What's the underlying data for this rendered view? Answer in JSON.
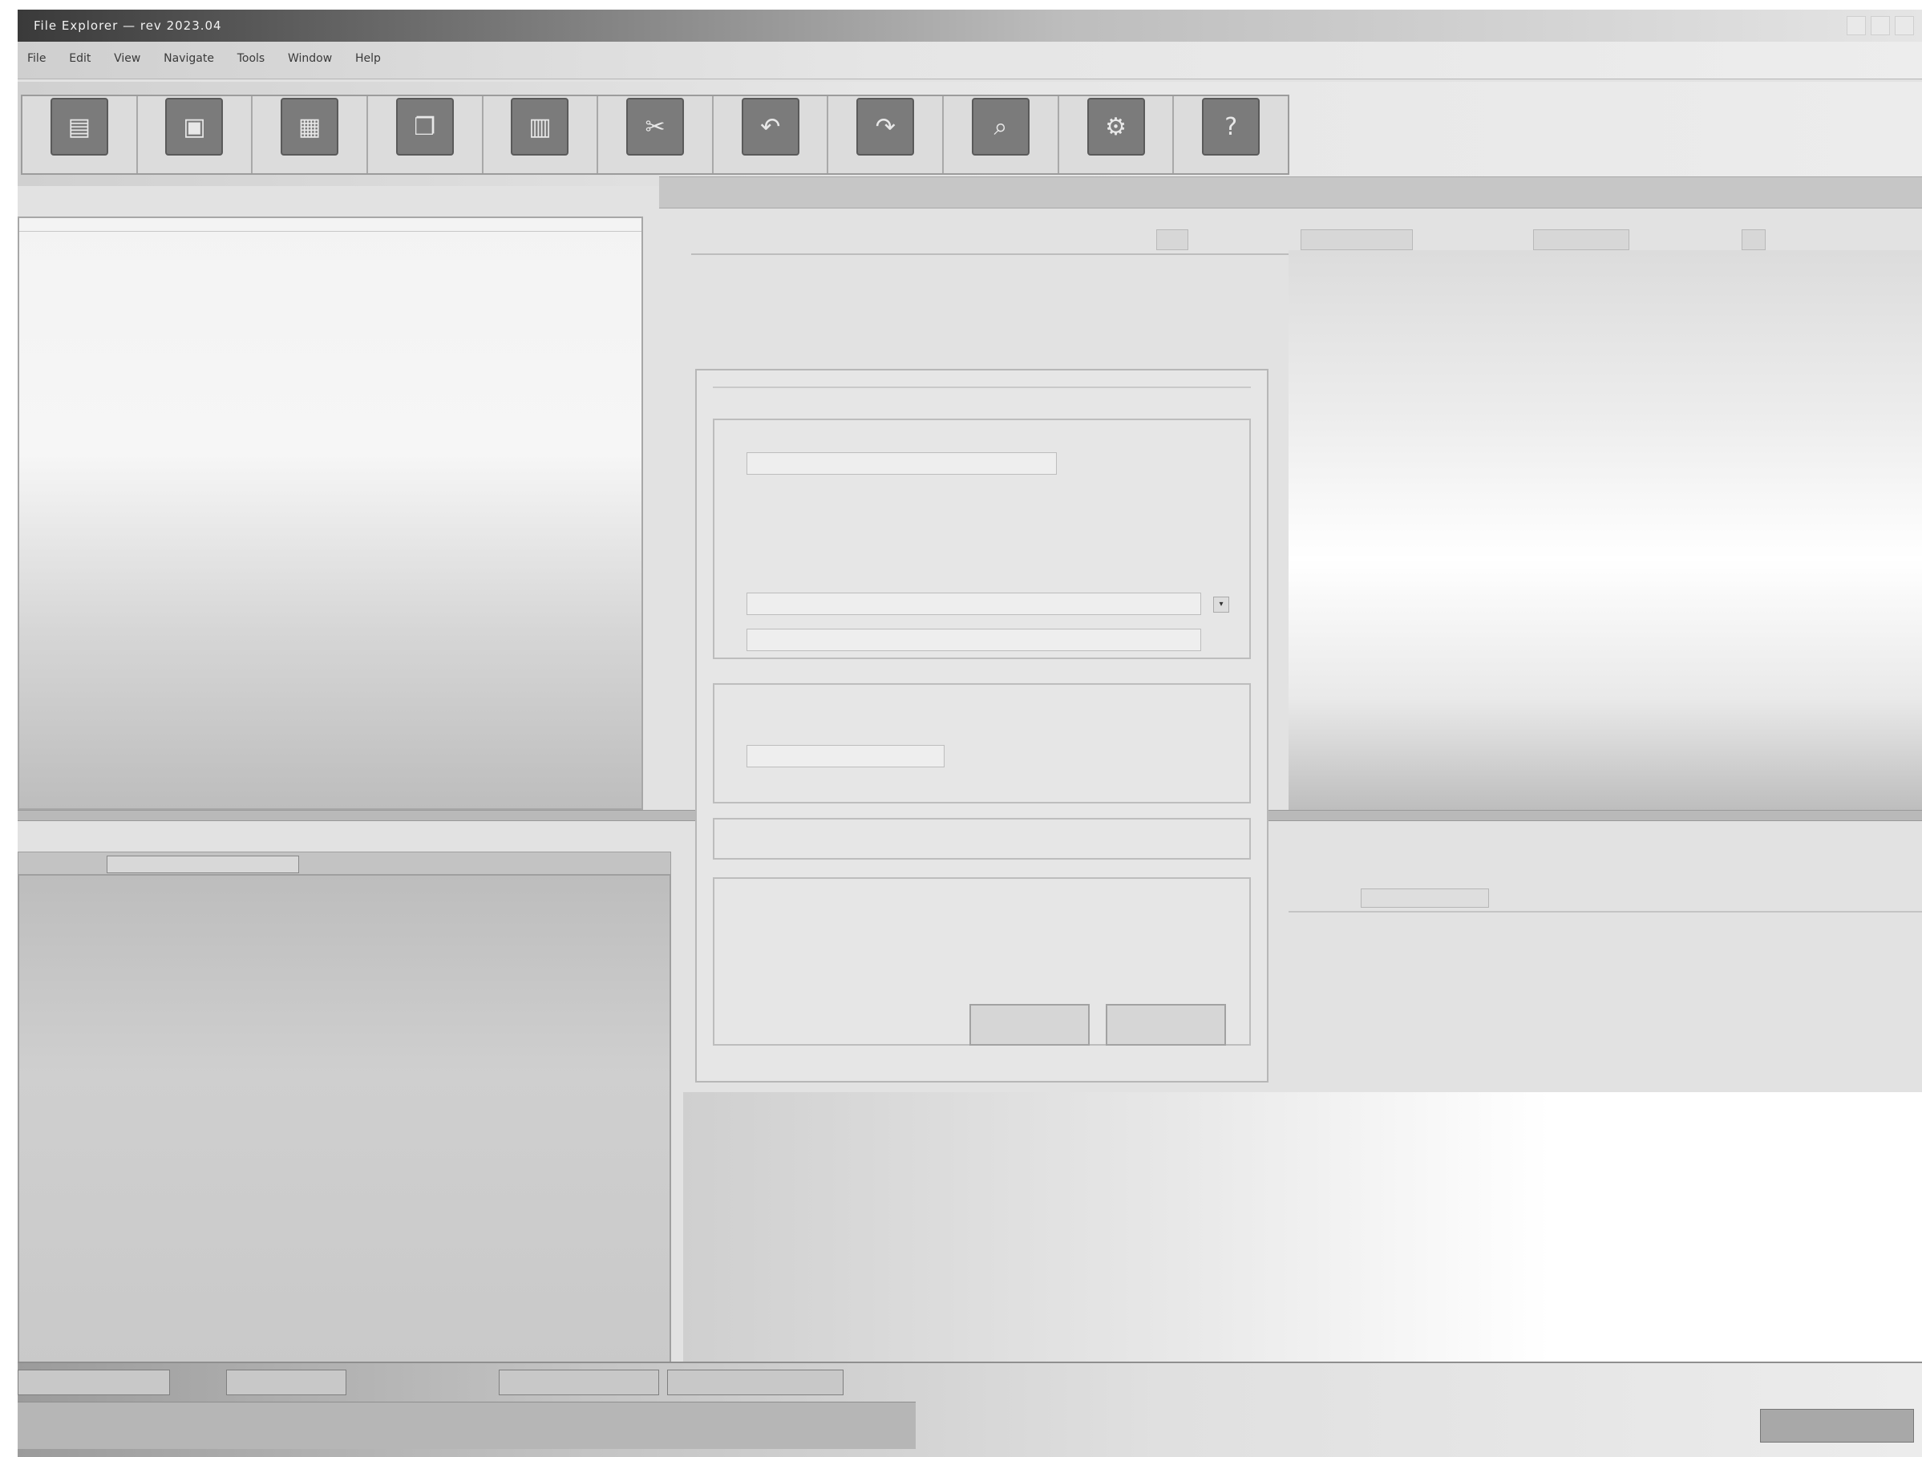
{
  "window": {
    "title": "File Explorer — rev 2023.04"
  },
  "menu": {
    "items": [
      "File",
      "Edit",
      "View",
      "Navigate",
      "Tools",
      "Window",
      "Help"
    ]
  },
  "toolbar": {
    "tools": [
      {
        "label": "",
        "icon": "folder-icon"
      },
      {
        "label": "",
        "icon": "save-icon"
      },
      {
        "label": "",
        "icon": "print-icon"
      },
      {
        "label": "",
        "icon": "copy-icon"
      },
      {
        "label": "",
        "icon": "paste-icon"
      },
      {
        "label": "",
        "icon": "cut-icon"
      },
      {
        "label": "",
        "icon": "undo-icon"
      },
      {
        "label": "",
        "icon": "redo-icon"
      },
      {
        "label": "",
        "icon": "search-icon"
      },
      {
        "label": "",
        "icon": "settings-icon"
      },
      {
        "label": "",
        "icon": "help-icon"
      }
    ]
  },
  "tabs": {
    "items": [
      "",
      "",
      "",
      ""
    ]
  },
  "tree": {
    "nodes": [
      "",
      "",
      ""
    ]
  },
  "lowerleft": {
    "tab_label": ""
  },
  "dialog": {
    "title": "",
    "field1": "",
    "field2": "",
    "button_ok": "",
    "button_cancel": ""
  },
  "rightpanel": {
    "tab_label": ""
  },
  "statusbar": {
    "seg1": "",
    "seg2": "",
    "seg3": "",
    "seg4": ""
  },
  "colors": {
    "titlebar_dark": "#3a3a3a",
    "panel_light": "#f3f3f3",
    "panel_dark": "#bdbdbd"
  }
}
